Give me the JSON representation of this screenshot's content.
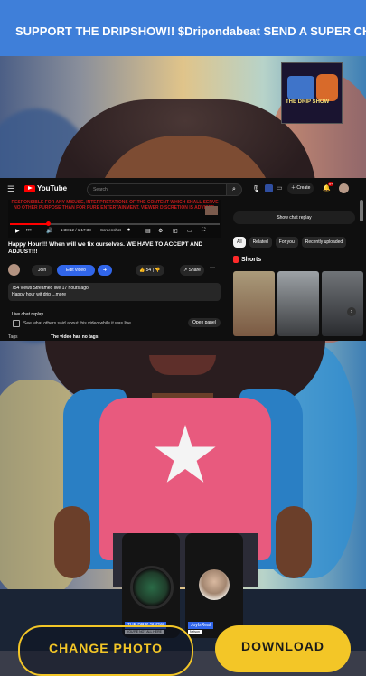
{
  "banner": {
    "text": "SUPPORT THE DRIPSHOW!! $Dripondabeat SEND A SUPER CHAT!!! HIT"
  },
  "album": {
    "text": "THE DRIP SHOW"
  },
  "youtube": {
    "logo": "YouTube",
    "search_placeholder": "Search",
    "create_label": "Create",
    "notification_count": "9+",
    "warning": "RESPONSIBLE FOR ANY MISUSE, INTERPRETATIONS OF THE CONTENT WHICH SHALL SERVE NO OTHER PURPOSE THAN FOR PURE ENTERTAINMENT. VIEWER DISCRETION IS ADVISED.",
    "time": "1:38:12 / 1:17:38",
    "screenshot_label": "Screenshot",
    "progress": 0.18,
    "title": "Happy Hour!!! When will we fix ourselves. WE HAVE TO ACCEPT AND ADJUST!!!",
    "join_label": "Join",
    "edit_label": "Edit video",
    "likes": "54",
    "share_label": "Share",
    "desc_stats": "754 views  Streamed live 17 hours ago",
    "desc_text": "Happy hour wit drip ...more",
    "chat_replay_heading": "Live chat replay",
    "chat_replay_text": "See what others said about this video while it was live.",
    "open_panel_label": "Open panel",
    "tags_label": "Tags",
    "tags_value": "The video has no tags",
    "show_chat_label": "Show chat replay",
    "chips": [
      "All",
      "Related",
      "For you",
      "Recently uploaded"
    ],
    "shorts_label": "Shorts"
  },
  "guests": [
    {
      "name": "THE DRIP SHOW",
      "sub": "YOU'RE NOT ALL HERE"
    },
    {
      "name": "JoyIsReal",
      "sub": "Nelson"
    }
  ],
  "buttons": {
    "change_photo": "CHANGE PHOTO",
    "download": "DOWNLOAD"
  },
  "colors": {
    "banner": "#3f7fd9",
    "accent": "#f3c627",
    "yt_red": "#ff0000",
    "yt_blue": "#3166ea"
  }
}
